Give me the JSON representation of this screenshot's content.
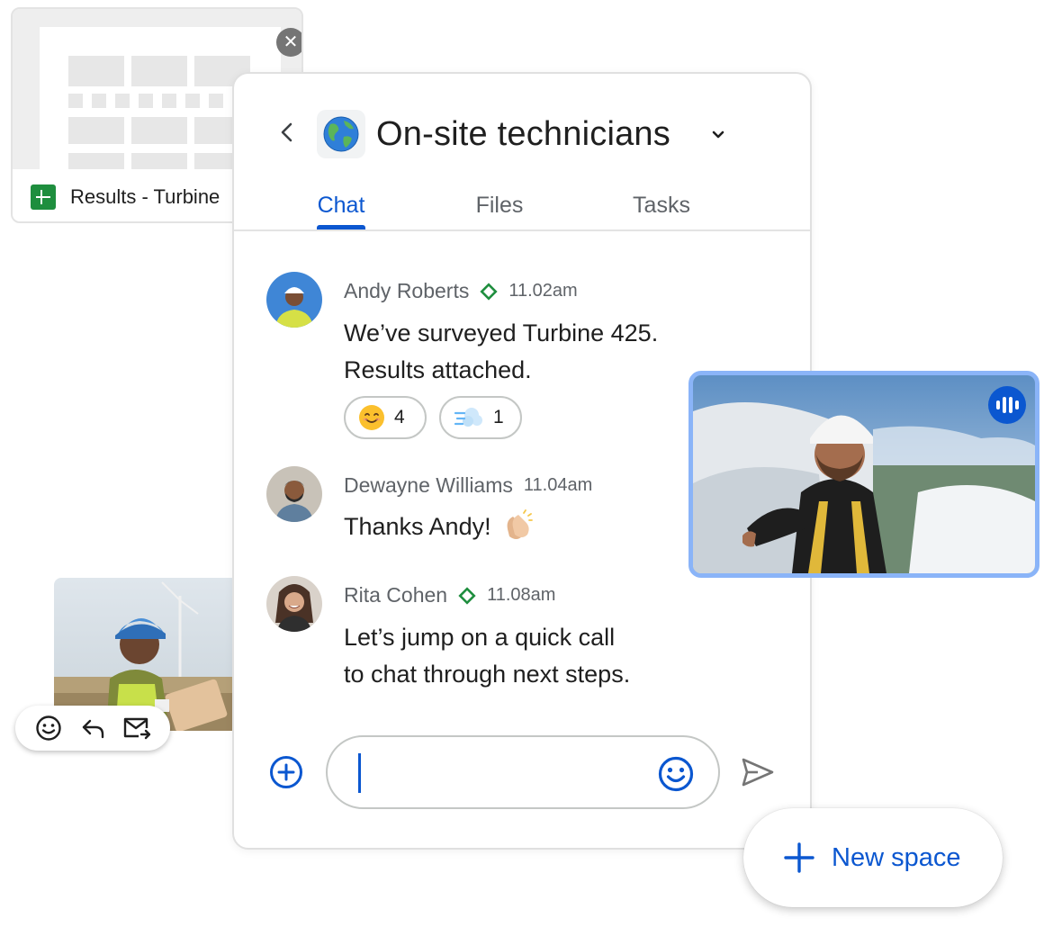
{
  "file_card": {
    "name": "Results - Turbine",
    "icon": "google-sheets-icon",
    "close_icon": "close-icon"
  },
  "chat": {
    "space_title": "On-site technicians",
    "space_icon": "globe-icon",
    "tabs": [
      {
        "label": "Chat",
        "active": true
      },
      {
        "label": "Files",
        "active": false
      },
      {
        "label": "Tasks",
        "active": false
      }
    ],
    "messages": [
      {
        "author": "Andy Roberts",
        "verified": true,
        "time": "11.02am",
        "lines": [
          "We’ve surveyed Turbine 425.",
          "Results attached."
        ],
        "reactions": [
          {
            "emoji": "smiling-face-emoji",
            "count": "4"
          },
          {
            "emoji": "wind-emoji",
            "count": "1"
          }
        ]
      },
      {
        "author": "Dewayne Williams",
        "verified": false,
        "time": "11.04am",
        "lines": [
          "Thanks Andy!"
        ],
        "trailing_emoji": "clapping-hands-emoji"
      },
      {
        "author": "Rita Cohen",
        "verified": true,
        "time": "11.08am",
        "lines": [
          "Let’s jump on a quick call",
          "to chat through next steps."
        ]
      }
    ],
    "composer": {
      "add_icon": "add-circle-icon",
      "emoji_icon": "emoji-icon",
      "send_icon": "send-icon"
    }
  },
  "actions": [
    "emoji-icon",
    "reply-icon",
    "forward-to-inbox-icon"
  ],
  "video": {
    "speaking_icon": "audio-speaking-icon"
  },
  "new_space": {
    "label": "New space"
  },
  "colors": {
    "accent": "#0b57d0",
    "video_border": "#8ab4f8",
    "verified": "#1e8e3e",
    "sheets": "#1e8e3e"
  }
}
